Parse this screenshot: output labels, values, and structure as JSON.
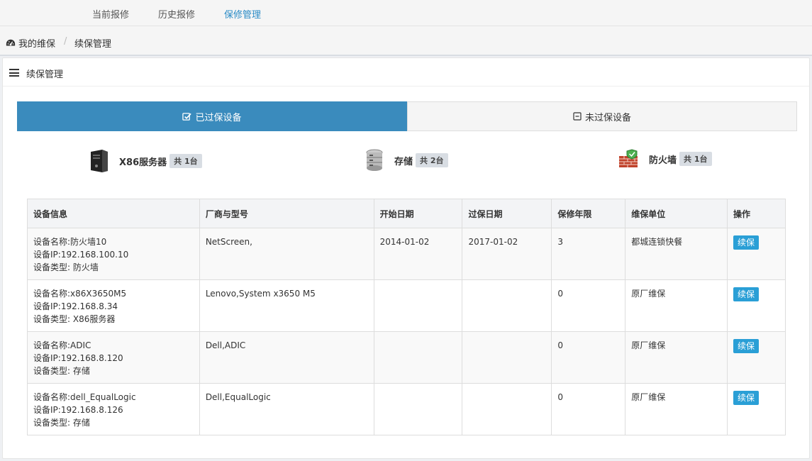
{
  "topnav": {
    "tabs": [
      {
        "label": "当前报修"
      },
      {
        "label": "历史报修"
      },
      {
        "label": "保修管理"
      }
    ]
  },
  "breadcrumb": {
    "home": "我的维保",
    "separator": "/",
    "current": "续保管理"
  },
  "panel": {
    "title": "续保管理"
  },
  "segments": {
    "active_label": "已过保设备",
    "inactive_label": "未过保设备"
  },
  "categories": [
    {
      "name": "X86服务器",
      "count": "共 1台",
      "icon": "server-icon"
    },
    {
      "name": "存储",
      "count": "共 2台",
      "icon": "storage-icon"
    },
    {
      "name": "防火墙",
      "count": "共 1台",
      "icon": "firewall-icon"
    }
  ],
  "table": {
    "headers": [
      "设备信息",
      "厂商与型号",
      "开始日期",
      "过保日期",
      "保修年限",
      "维保单位",
      "操作"
    ],
    "rows": [
      {
        "name": "设备名称:防火墙10",
        "ip": "设备IP:192.168.100.10",
        "type": "设备类型: 防火墙",
        "vendor": "NetScreen,",
        "start": "2014-01-02",
        "expire": "2017-01-02",
        "years": "3",
        "unit": "都城连锁快餐",
        "action": "续保"
      },
      {
        "name": "设备名称:x86X3650M5",
        "ip": "设备IP:192.168.8.34",
        "type": "设备类型: X86服务器",
        "vendor": "Lenovo,System x3650 M5",
        "start": "",
        "expire": "",
        "years": "0",
        "unit": "原厂维保",
        "action": "续保"
      },
      {
        "name": "设备名称:ADIC",
        "ip": "设备IP:192.168.8.120",
        "type": "设备类型: 存储",
        "vendor": "Dell,ADIC",
        "start": "",
        "expire": "",
        "years": "0",
        "unit": "原厂维保",
        "action": "续保"
      },
      {
        "name": "设备名称:dell_EqualLogic",
        "ip": "设备IP:192.168.8.126",
        "type": "设备类型: 存储",
        "vendor": "Dell,EqualLogic",
        "start": "",
        "expire": "",
        "years": "0",
        "unit": "原厂维保",
        "action": "续保"
      }
    ]
  },
  "colors": {
    "accent": "#3a8bbd",
    "button": "#2a9fd6",
    "active_tab": "#2a8bc6"
  }
}
